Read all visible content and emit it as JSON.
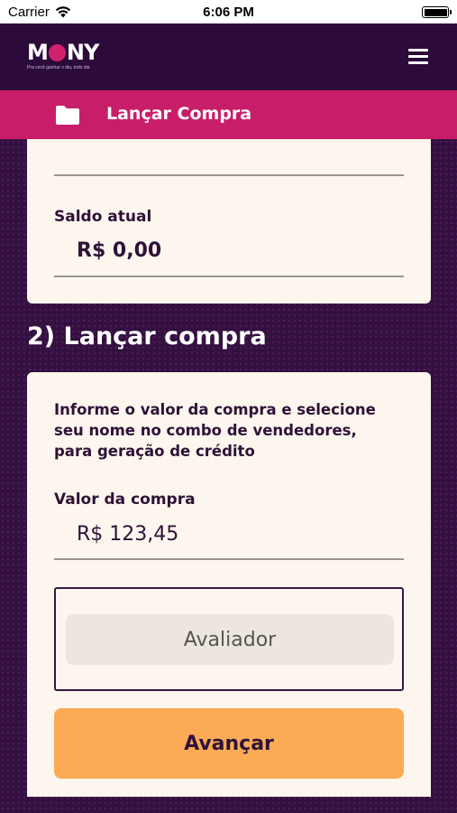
{
  "status_bar": {
    "carrier": "Carrier",
    "time": "6:06 PM"
  },
  "header": {
    "logo_text_left": "M",
    "logo_text_right": "NY",
    "tagline": "Pra você ganhar o dia, todo dia",
    "menu_icon": "hamburger-icon"
  },
  "page": {
    "title": "Lançar Compra",
    "icon": "folder-icon"
  },
  "balance": {
    "label": "Saldo atual",
    "value": "R$ 0,00"
  },
  "purchase": {
    "section_title": "2) Lançar compra",
    "instructions": "Informe o valor da compra e selecione seu nome no combo de vendedores, para geração de crédito",
    "amount_label": "Valor da compra",
    "amount_value": "R$ 123,45",
    "seller_select": "Avaliador",
    "submit_label": "Avançar"
  },
  "colors": {
    "header_bg": "#2c0b3a",
    "title_bar": "#c81e6a",
    "button": "#fbab55",
    "card_bg": "#fcf6ee",
    "text_dark": "#2f1237"
  }
}
